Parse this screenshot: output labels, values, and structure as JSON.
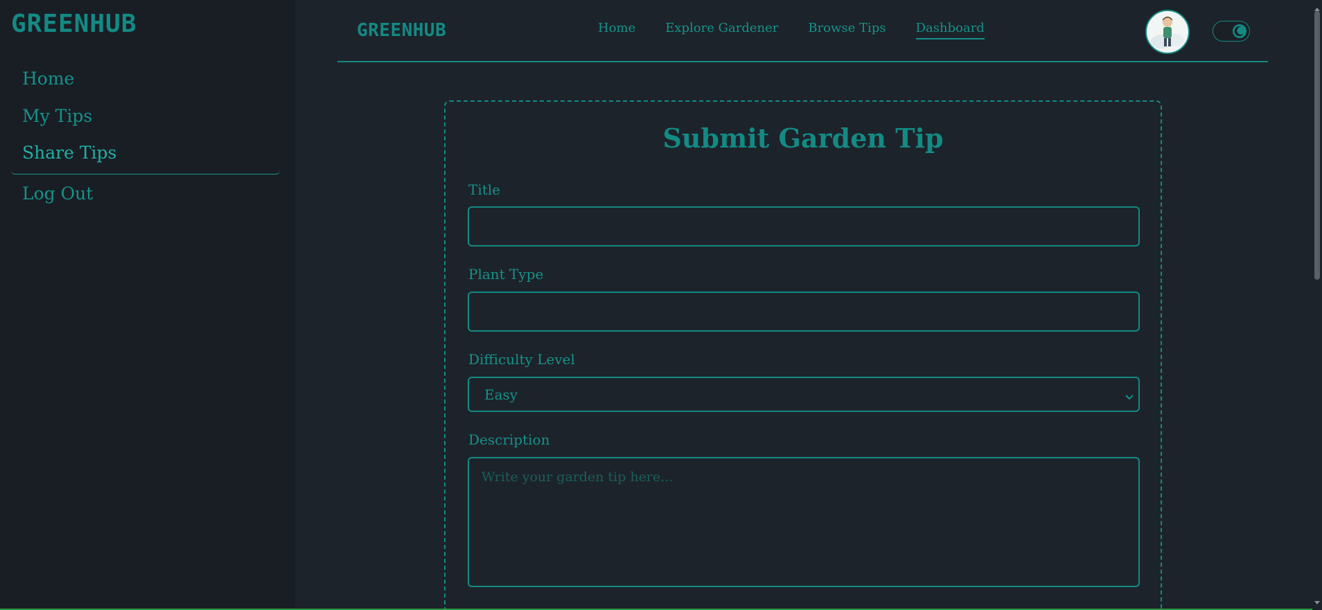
{
  "sidebar": {
    "logo": "GREENHUB",
    "items": [
      {
        "label": "Home"
      },
      {
        "label": "My Tips"
      },
      {
        "label": "Share Tips"
      },
      {
        "label": "Log Out"
      }
    ],
    "active_item": "Share Tips"
  },
  "topbar": {
    "logo": "GREENHUB",
    "links": [
      {
        "label": "Home"
      },
      {
        "label": "Explore Gardener"
      },
      {
        "label": "Browse Tips"
      },
      {
        "label": "Dashboard"
      }
    ],
    "active_link": "Dashboard",
    "avatar_icon": "user-avatar-icon",
    "theme_toggle_icon": "moon-icon"
  },
  "form": {
    "title": "Submit Garden Tip",
    "fields": {
      "title_label": "Title",
      "title_value": "",
      "plant_type_label": "Plant Type",
      "plant_type_value": "",
      "difficulty_label": "Difficulty Level",
      "difficulty_value": "Easy",
      "description_label": "Description",
      "description_placeholder": "Write your garden tip here..."
    }
  },
  "colors": {
    "background": "#1d232a",
    "sidebar": "#191e24",
    "accent": "#138a84"
  }
}
